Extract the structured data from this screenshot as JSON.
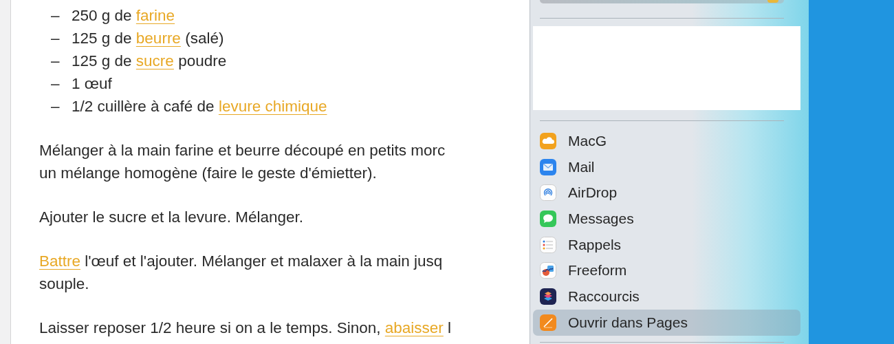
{
  "document": {
    "ingredients": [
      {
        "marker": "–",
        "parts": [
          {
            "text": "250 g de "
          },
          {
            "text": "farine",
            "kind": "link"
          }
        ]
      },
      {
        "marker": "–",
        "parts": [
          {
            "text": "125 g de "
          },
          {
            "text": "beurre",
            "kind": "link"
          },
          {
            "text": " (salé)"
          }
        ]
      },
      {
        "marker": "–",
        "parts": [
          {
            "text": "125 g de "
          },
          {
            "text": "sucre",
            "kind": "link"
          },
          {
            "text": " poudre"
          }
        ]
      },
      {
        "marker": "–",
        "parts": [
          {
            "text": "1 œuf"
          }
        ]
      },
      {
        "marker": "–",
        "parts": [
          {
            "text": "1/2 cuillère à café de "
          },
          {
            "text": "levure chimique",
            "kind": "link"
          }
        ]
      }
    ],
    "paragraphs": [
      {
        "lines": [
          [
            {
              "text": "Mélanger à la main farine et beurre découpé en petits morc"
            }
          ],
          [
            {
              "text": "un mélange homogène (faire le geste d'émietter)."
            }
          ]
        ]
      },
      {
        "lines": [
          [
            {
              "text": "Ajouter le sucre et la levure. Mélanger."
            }
          ]
        ]
      },
      {
        "lines": [
          [
            {
              "text": "Battre",
              "kind": "link"
            },
            {
              "text": " l'œuf et l'ajouter. Mélanger et malaxer à la main jusq"
            }
          ],
          [
            {
              "text": "souple."
            }
          ]
        ]
      },
      {
        "lines": [
          [
            {
              "text": "Laisser reposer 1/2 heure si on a le temps. Sinon, "
            },
            {
              "text": "abaisser",
              "kind": "link"
            },
            {
              "text": " l"
            }
          ]
        ]
      }
    ]
  },
  "share_menu": {
    "items": [
      {
        "label": "MacG",
        "selected": false
      },
      {
        "label": "Mail",
        "selected": false
      },
      {
        "label": "AirDrop",
        "selected": false
      },
      {
        "label": "Messages",
        "selected": false
      },
      {
        "label": "Rappels",
        "selected": false
      },
      {
        "label": "Freeform",
        "selected": false
      },
      {
        "label": "Raccourcis",
        "selected": false
      },
      {
        "label": "Ouvrir dans Pages",
        "selected": true
      }
    ]
  }
}
